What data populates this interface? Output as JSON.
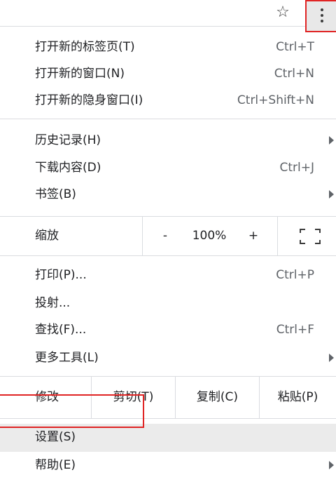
{
  "toolbar": {
    "bookmark_icon": "star-outline-icon",
    "menu_icon": "vertical-ellipsis-icon",
    "bookmark_glyph": "☆"
  },
  "menu": {
    "group1": [
      {
        "label": "打开新的标签页(T)",
        "shortcut": "Ctrl+T"
      },
      {
        "label": "打开新的窗口(N)",
        "shortcut": "Ctrl+N"
      },
      {
        "label": "打开新的隐身窗口(I)",
        "shortcut": "Ctrl+Shift+N"
      }
    ],
    "group2": [
      {
        "label": "历史记录(H)",
        "submenu": true
      },
      {
        "label": "下载内容(D)",
        "shortcut": "Ctrl+J"
      },
      {
        "label": "书签(B)",
        "submenu": true
      }
    ],
    "zoom": {
      "label": "缩放",
      "minus": "-",
      "level": "100%",
      "plus": "+",
      "fullscreen_icon": "fullscreen-icon"
    },
    "group3": [
      {
        "label": "打印(P)...",
        "shortcut": "Ctrl+P"
      },
      {
        "label": "投射..."
      },
      {
        "label": "查找(F)...",
        "shortcut": "Ctrl+F"
      },
      {
        "label": "更多工具(L)",
        "submenu": true
      }
    ],
    "edit": {
      "label": "修改",
      "cut": "剪切(T)",
      "copy": "复制(C)",
      "paste": "粘贴(P)"
    },
    "group4": [
      {
        "label": "设置(S)",
        "highlighted": true
      },
      {
        "label": "帮助(E)",
        "submenu": true
      }
    ]
  },
  "colors": {
    "highlight_border": "#e02424",
    "hover_background": "#ebebeb",
    "separator": "#dadce0"
  }
}
